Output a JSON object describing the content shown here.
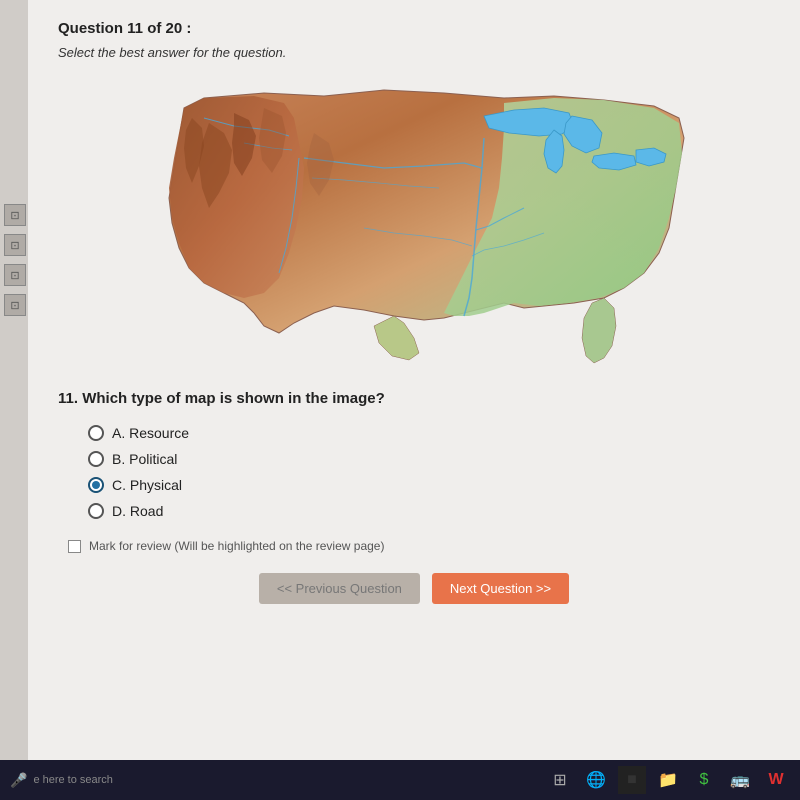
{
  "header": {
    "question_counter": "Question 11 of 20 :",
    "instruction": "Select the best answer for the question."
  },
  "question": {
    "number": "11.",
    "text": "Which type of map is shown in the image?"
  },
  "choices": [
    {
      "id": "A",
      "label": "A. Resource",
      "selected": false
    },
    {
      "id": "B",
      "label": "B. Political",
      "selected": false
    },
    {
      "id": "C",
      "label": "C. Physical",
      "selected": true
    },
    {
      "id": "D",
      "label": "D. Road",
      "selected": false
    }
  ],
  "mark_review": {
    "label": "Mark for review (Will be highlighted on the review page)"
  },
  "navigation": {
    "prev_label": "<< Previous Question",
    "next_label": "Next Question >>"
  },
  "sidebar_icons": [
    "⊡",
    "⊡",
    "⊡",
    "⊡"
  ],
  "taskbar": {
    "search_text": "e here to search"
  }
}
